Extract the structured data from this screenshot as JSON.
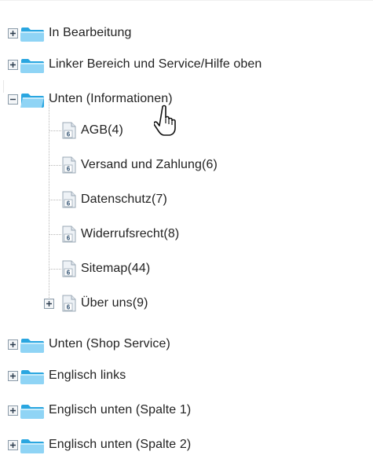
{
  "tree": {
    "nodes": [
      {
        "label": "In Bearbeitung",
        "state": "collapsed",
        "icon": "folder-icon"
      },
      {
        "label": "Linker Bereich und Service/Hilfe oben",
        "state": "collapsed",
        "icon": "folder-icon"
      },
      {
        "label": "Unten (Informationen)",
        "state": "expanded",
        "icon": "folder-open-icon",
        "children": [
          {
            "label": "AGB(4)",
            "icon": "page-icon",
            "badge": "6"
          },
          {
            "label": "Versand und Zahlung(6)",
            "icon": "page-icon",
            "badge": "6"
          },
          {
            "label": "Datenschutz(7)",
            "icon": "page-icon",
            "badge": "6"
          },
          {
            "label": "Widerrufsrecht(8)",
            "icon": "page-icon",
            "badge": "6"
          },
          {
            "label": "Sitemap(44)",
            "icon": "page-icon",
            "badge": "6"
          },
          {
            "label": "Über uns(9)",
            "icon": "page-icon",
            "badge": "6",
            "state": "collapsed"
          }
        ]
      },
      {
        "label": "Unten (Shop Service)",
        "state": "collapsed",
        "icon": "folder-icon"
      },
      {
        "label": "Englisch links",
        "state": "collapsed",
        "icon": "folder-icon"
      },
      {
        "label": "Englisch unten (Spalte 1)",
        "state": "collapsed",
        "icon": "folder-icon"
      },
      {
        "label": "Englisch unten (Spalte 2)",
        "state": "collapsed",
        "icon": "folder-icon"
      }
    ]
  },
  "colors": {
    "folder_light": "#8fd4f5",
    "folder_dark": "#2aa6e0",
    "expander_border": "#8a9aa8",
    "text": "#222222"
  },
  "cursor": {
    "icon": "hand-pointer-icon"
  }
}
